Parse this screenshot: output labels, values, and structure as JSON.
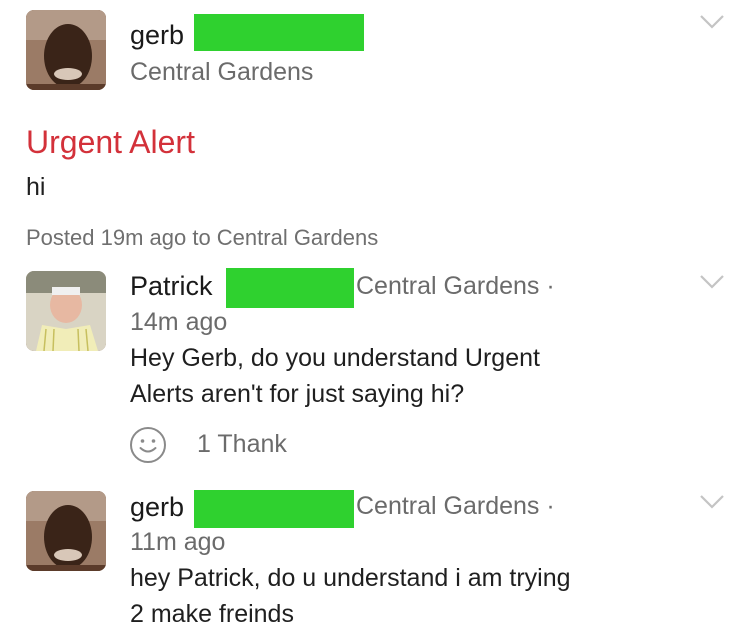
{
  "post": {
    "author": "gerb",
    "neighborhood": "Central Gardens",
    "alert_title": "Urgent Alert",
    "body": "hi",
    "meta": "Posted 19m ago to Central Gardens"
  },
  "comments": [
    {
      "author": "Patrick",
      "neighborhood": "Central Gardens ·",
      "time": "14m ago",
      "lines": [
        "Hey Gerb, do you understand Urgent",
        "Alerts aren't for just saying hi?"
      ],
      "thanks": "1 Thank"
    },
    {
      "author": "gerb",
      "neighborhood": "Central Gardens ·",
      "time": "11m ago",
      "lines": [
        "hey Patrick, do u understand i am trying",
        "2 make freinds"
      ]
    }
  ],
  "colors": {
    "alert_red": "#d3313a",
    "redaction_green": "#2fd12f",
    "muted_text": "#6b6b6b"
  },
  "icons": [
    "chevron-down-icon",
    "smiley-icon"
  ]
}
